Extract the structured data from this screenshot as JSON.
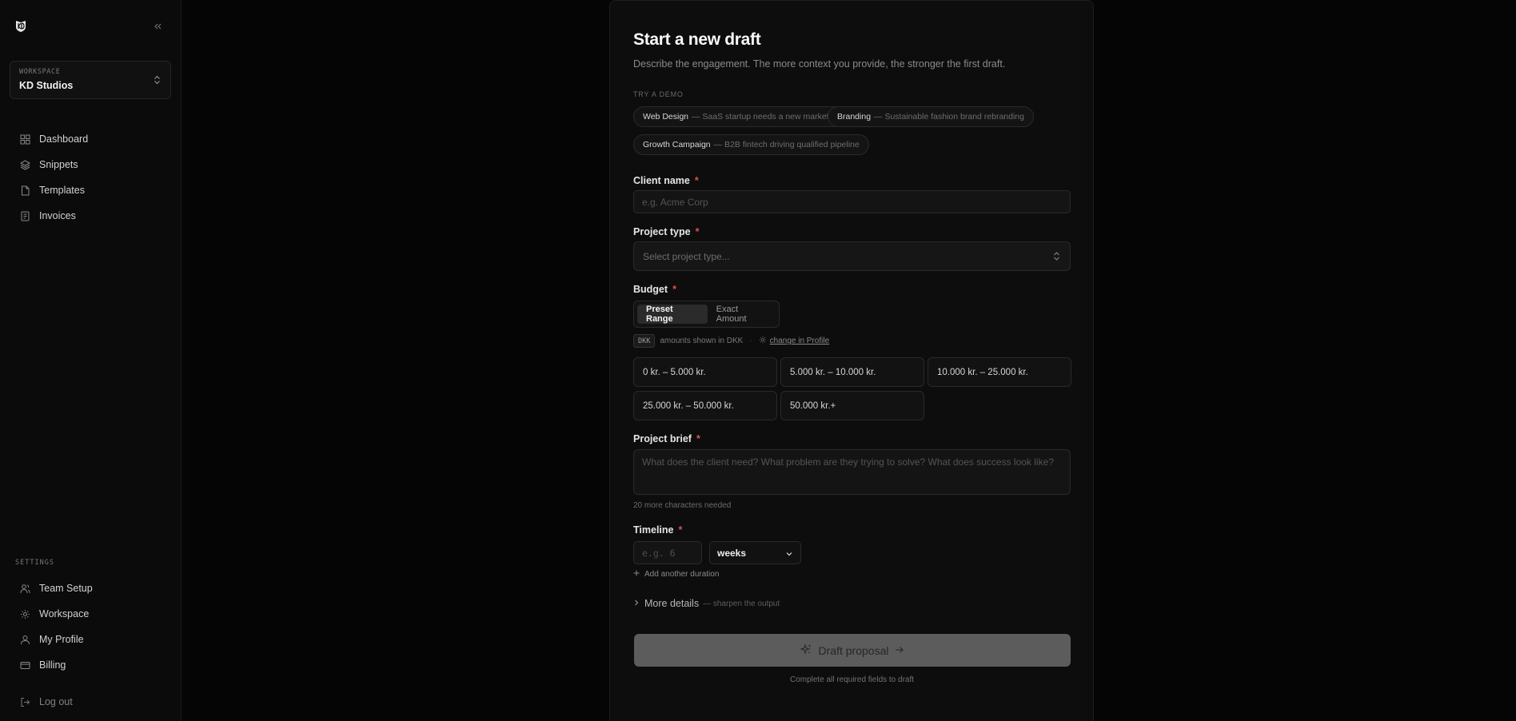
{
  "sidebar": {
    "workspace_label": "WORKSPACE",
    "workspace_name": "KD Studios",
    "nav": [
      {
        "label": "Dashboard",
        "icon": "grid-icon"
      },
      {
        "label": "Snippets",
        "icon": "layers-icon"
      },
      {
        "label": "Templates",
        "icon": "file-icon"
      },
      {
        "label": "Invoices",
        "icon": "receipt-icon"
      }
    ],
    "settings_label": "SETTINGS",
    "settings_nav": [
      {
        "label": "Team Setup",
        "icon": "users-icon"
      },
      {
        "label": "Workspace",
        "icon": "gear-icon"
      },
      {
        "label": "My Profile",
        "icon": "user-icon"
      },
      {
        "label": "Billing",
        "icon": "credit-card-icon"
      }
    ],
    "logout_label": "Log out"
  },
  "form": {
    "title": "Start a new draft",
    "subtitle": "Describe the engagement. The more context you provide, the stronger the first draft.",
    "demo_label": "TRY A DEMO",
    "demos": [
      {
        "title": "Web Design",
        "desc": "— SaaS startup needs a new marketing site"
      },
      {
        "title": "Branding",
        "desc": "— Sustainable fashion brand rebranding"
      },
      {
        "title": "Growth Campaign",
        "desc": "— B2B fintech driving qualified pipeline"
      }
    ],
    "client_name": {
      "label": "Client name",
      "required": "*",
      "placeholder": "e.g. Acme Corp"
    },
    "project_type": {
      "label": "Project type",
      "required": "*",
      "placeholder": "Select project type..."
    },
    "budget": {
      "label": "Budget",
      "required": "*",
      "modes": [
        "Preset Range",
        "Exact Amount"
      ],
      "active_mode": "Preset Range",
      "currency_code": "DKK",
      "currency_note": "amounts shown in DKK",
      "change_link": "change in Profile",
      "ranges": [
        "0 kr. – 5.000 kr.",
        "5.000 kr. – 10.000 kr.",
        "10.000 kr. – 25.000 kr.",
        "25.000 kr. – 50.000 kr.",
        "50.000 kr.+"
      ]
    },
    "brief": {
      "label": "Project brief",
      "required": "*",
      "placeholder": "What does the client need? What problem are they trying to solve? What does success look like?",
      "helper": "20 more characters needed"
    },
    "timeline": {
      "label": "Timeline",
      "required": "*",
      "placeholder": "e.g. 6",
      "unit": "weeks",
      "add_label": "Add another duration"
    },
    "more_details": {
      "title": "More details",
      "subtitle": "— sharpen the output"
    },
    "submit_label": "Draft proposal",
    "submit_note": "Complete all required fields to draft"
  },
  "colors": {
    "accent_required": "#d9534f",
    "background": "#050505",
    "card": "#0d0d0d"
  }
}
